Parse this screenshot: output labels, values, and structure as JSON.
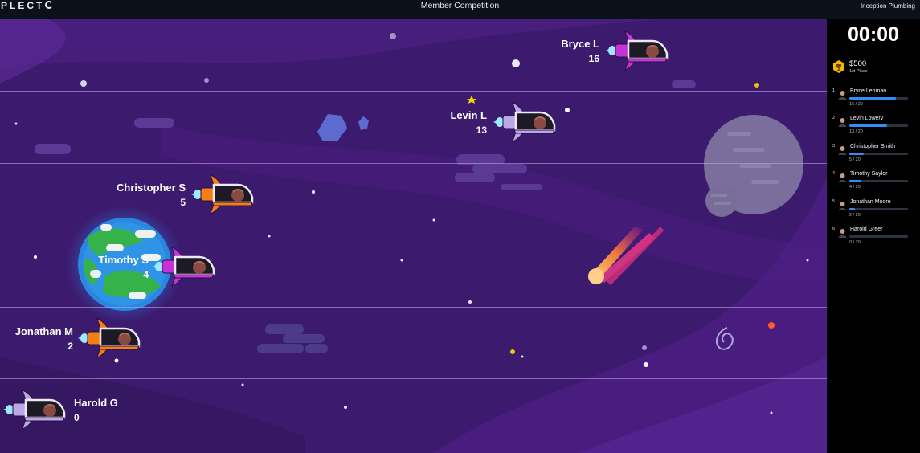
{
  "header": {
    "logo_text": "PLECT",
    "title": "Member Competition",
    "company": "Inception Plumbing"
  },
  "sidebar": {
    "timer": "00:00",
    "prize_amount": "$500",
    "prize_label": "1st Place",
    "leaderboard": [
      {
        "rank": "1",
        "name": "Bryce Lehman",
        "progress": "16 / 20",
        "fraction": 0.8
      },
      {
        "rank": "2",
        "name": "Levin Lowery",
        "progress": "13 / 20",
        "fraction": 0.65
      },
      {
        "rank": "3",
        "name": "Christopher Smith",
        "progress": "5 / 20",
        "fraction": 0.25
      },
      {
        "rank": "4",
        "name": "Timothy Saylor",
        "progress": "4 / 20",
        "fraction": 0.2
      },
      {
        "rank": "5",
        "name": "Jonathan Moore",
        "progress": "2 / 20",
        "fraction": 0.1
      },
      {
        "rank": "6",
        "name": "Harold Greer",
        "progress": "0 / 20",
        "fraction": 0.0
      }
    ]
  },
  "race": {
    "goal": 20,
    "racers": [
      {
        "name": "Bryce L",
        "score": "16",
        "value": 16,
        "ship_color": "#c532d8"
      },
      {
        "name": "Levin L",
        "score": "13",
        "value": 13,
        "ship_color": "#b9a9e6"
      },
      {
        "name": "Christopher S",
        "score": "5",
        "value": 5,
        "ship_color": "#f57f17"
      },
      {
        "name": "Timothy S",
        "score": "4",
        "value": 4,
        "ship_color": "#c532d8"
      },
      {
        "name": "Jonathan M",
        "score": "2",
        "value": 2,
        "ship_color": "#f57f17"
      },
      {
        "name": "Harold G",
        "score": "0",
        "value": 0,
        "ship_color": "#b9a9e6"
      }
    ]
  },
  "colors": {
    "space_bg": "#3c1a6e",
    "sidebar_bg": "#000000",
    "progress_blue": "#2f8ff5",
    "prize_gold": "#f5b800"
  }
}
